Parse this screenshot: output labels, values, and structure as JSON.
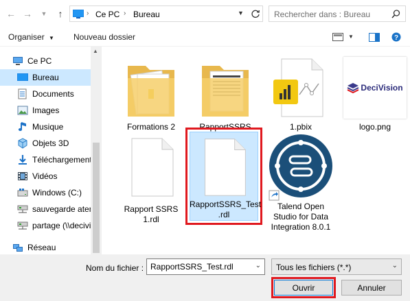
{
  "address": {
    "crumbs": [
      "Ce PC",
      "Bureau"
    ],
    "search_placeholder": "Rechercher dans : Bureau"
  },
  "commands": {
    "organize_label": "Organiser",
    "new_folder_label": "Nouveau dossier"
  },
  "nav": {
    "items": [
      {
        "label": "Ce PC",
        "icon": "computer-icon"
      },
      {
        "label": "Bureau",
        "icon": "desktop-icon",
        "selected": true
      },
      {
        "label": "Documents",
        "icon": "documents-icon"
      },
      {
        "label": "Images",
        "icon": "images-icon"
      },
      {
        "label": "Musique",
        "icon": "music-icon"
      },
      {
        "label": "Objets 3D",
        "icon": "3d-objects-icon"
      },
      {
        "label": "Téléchargements",
        "icon": "downloads-icon"
      },
      {
        "label": "Vidéos",
        "icon": "videos-icon"
      },
      {
        "label": "Windows (C:)",
        "icon": "drive-icon"
      },
      {
        "label": "sauvegarde atem",
        "icon": "network-drive-icon"
      },
      {
        "label": "partage (\\\\decivi",
        "icon": "network-drive-icon"
      },
      {
        "label": "Réseau",
        "icon": "network-icon"
      }
    ]
  },
  "files": [
    {
      "name": "Formations 2",
      "icon": "folder-icon"
    },
    {
      "name": "RapportSSRS",
      "icon": "folder-icon"
    },
    {
      "name": "1.pbix",
      "icon": "pbix-file-icon"
    },
    {
      "name": "logo.png",
      "icon": "image-file-icon",
      "logo_text": "DeciVision"
    },
    {
      "name": "Rapport SSRS\n1.rdl",
      "icon": "blank-file-icon"
    },
    {
      "name": "RapportSSRS_Test\n.rdl",
      "icon": "blank-file-icon",
      "selected": true
    },
    {
      "name": "Talend Open\nStudio for Data\nIntegration 8.0.1",
      "icon": "talend-shortcut-icon"
    }
  ],
  "footer": {
    "filename_label": "Nom du fichier :",
    "filename_value": "RapportSSRS_Test.rdl",
    "filetype_value": "Tous les fichiers (*.*)",
    "open_label": "Ouvrir",
    "cancel_label": "Annuler"
  },
  "colors": {
    "selection": "#cce8ff",
    "highlight_red": "#e0191f",
    "accent_blue": "#0078d7"
  }
}
